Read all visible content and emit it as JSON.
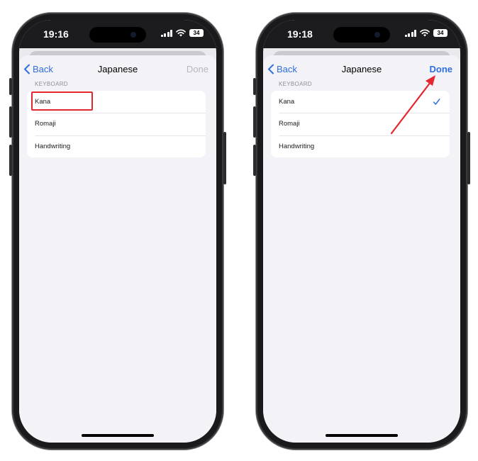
{
  "colors": {
    "ios_blue": "#2f6fe0",
    "annotation_red": "#e4262f",
    "done_disabled": "#b7b7bc"
  },
  "left_phone": {
    "status": {
      "time": "19:16",
      "battery": "34"
    },
    "nav": {
      "back_label": "Back",
      "title": "Japanese",
      "done_label": "Done",
      "done_enabled": false
    },
    "section_header": "KEYBOARD",
    "rows": [
      {
        "label": "Kana",
        "checked": false
      },
      {
        "label": "Romaji",
        "checked": false
      },
      {
        "label": "Handwriting",
        "checked": false
      }
    ],
    "annotation": "highlight-box-around-kana"
  },
  "right_phone": {
    "status": {
      "time": "19:18",
      "battery": "34"
    },
    "nav": {
      "back_label": "Back",
      "title": "Japanese",
      "done_label": "Done",
      "done_enabled": true
    },
    "section_header": "KEYBOARD",
    "rows": [
      {
        "label": "Kana",
        "checked": true
      },
      {
        "label": "Romaji",
        "checked": false
      },
      {
        "label": "Handwriting",
        "checked": false
      }
    ],
    "annotation": "arrow-pointing-to-done"
  }
}
